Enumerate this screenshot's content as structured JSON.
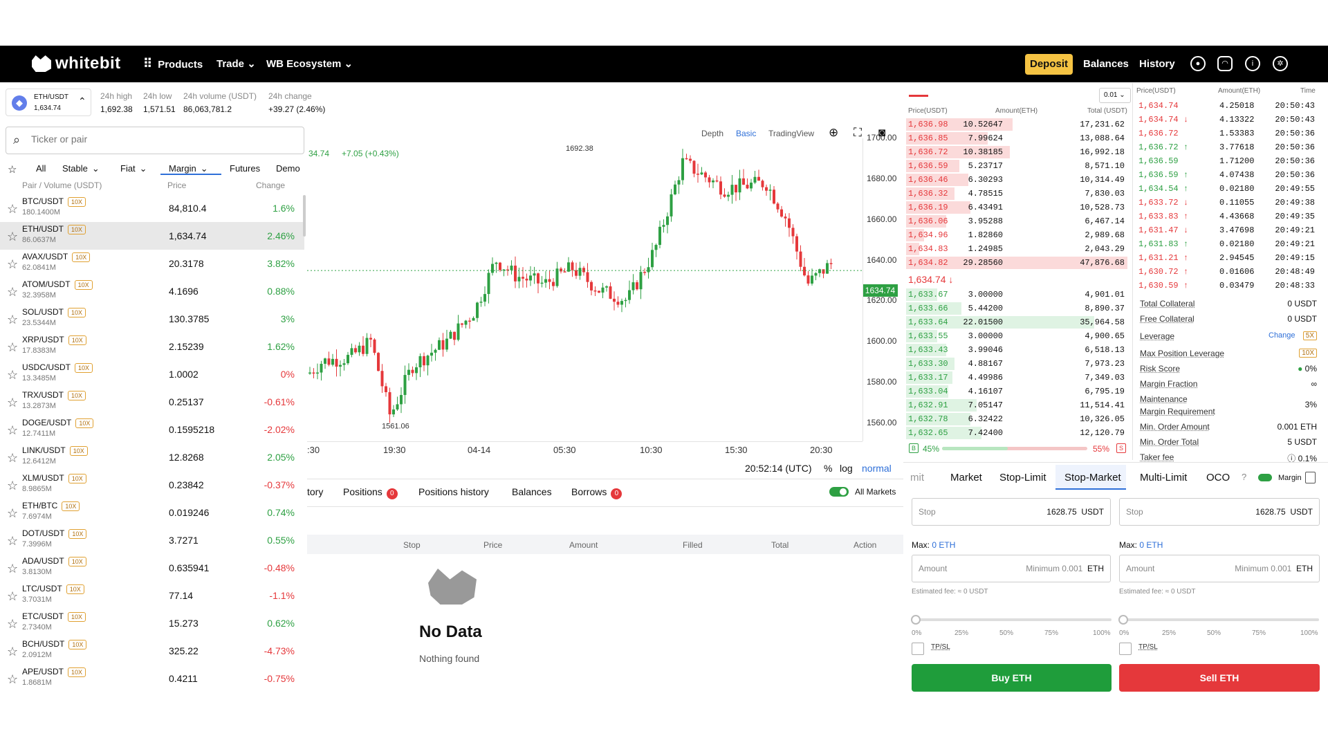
{
  "header": {
    "logo": "whitebit",
    "nav": {
      "products": "Products",
      "trade": "Trade",
      "ecosystem": "WB Ecosystem"
    },
    "deposit": "Deposit",
    "balances": "Balances",
    "history": "History"
  },
  "ticker": {
    "pair": "ETH/USDT",
    "price": "1,634.74",
    "high_label": "24h high",
    "high": "1,692.38",
    "low_label": "24h low",
    "low": "1,571.51",
    "vol_label": "24h volume (USDT)",
    "vol": "86,063,781.2",
    "chg_label": "24h change",
    "chg": "+39.27  (2.46%)"
  },
  "markets": {
    "search_placeholder": "Ticker or pair",
    "filters": [
      "All",
      "Stable",
      "Fiat",
      "Margin",
      "Futures",
      "Demo"
    ],
    "head": {
      "pair": "Pair / Volume (USDT)",
      "price": "Price",
      "change": "Change"
    },
    "rows": [
      {
        "pair": "BTC/USDT",
        "lev": "10X",
        "vol": "180.1400M",
        "price": "84,810.4",
        "chg": "1.6%",
        "up": true
      },
      {
        "pair": "ETH/USDT",
        "lev": "10X",
        "vol": "86.0637M",
        "price": "1,634.74",
        "chg": "2.46%",
        "up": true
      },
      {
        "pair": "AVAX/USDT",
        "lev": "10X",
        "vol": "62.0841M",
        "price": "20.3178",
        "chg": "3.82%",
        "up": true
      },
      {
        "pair": "ATOM/USDT",
        "lev": "10X",
        "vol": "32.3958M",
        "price": "4.1696",
        "chg": "0.88%",
        "up": true
      },
      {
        "pair": "SOL/USDT",
        "lev": "10X",
        "vol": "23.5344M",
        "price": "130.3785",
        "chg": "3%",
        "up": true
      },
      {
        "pair": "XRP/USDT",
        "lev": "10X",
        "vol": "17.8383M",
        "price": "2.15239",
        "chg": "1.62%",
        "up": true
      },
      {
        "pair": "USDC/USDT",
        "lev": "10X",
        "vol": "13.3485M",
        "price": "1.0002",
        "chg": "0%",
        "up": false
      },
      {
        "pair": "TRX/USDT",
        "lev": "10X",
        "vol": "13.2873M",
        "price": "0.25137",
        "chg": "-0.61%",
        "up": false
      },
      {
        "pair": "DOGE/USDT",
        "lev": "10X",
        "vol": "12.7411M",
        "price": "0.1595218",
        "chg": "-2.02%",
        "up": false
      },
      {
        "pair": "LINK/USDT",
        "lev": "10X",
        "vol": "12.6412M",
        "price": "12.8268",
        "chg": "2.05%",
        "up": true
      },
      {
        "pair": "XLM/USDT",
        "lev": "10X",
        "vol": "8.9865M",
        "price": "0.23842",
        "chg": "-0.37%",
        "up": false
      },
      {
        "pair": "ETH/BTC",
        "lev": "10X",
        "vol": "7.6974M",
        "price": "0.019246",
        "chg": "0.74%",
        "up": true
      },
      {
        "pair": "DOT/USDT",
        "lev": "10X",
        "vol": "7.3996M",
        "price": "3.7271",
        "chg": "0.55%",
        "up": true
      },
      {
        "pair": "ADA/USDT",
        "lev": "10X",
        "vol": "3.8130M",
        "price": "0.635941",
        "chg": "-0.48%",
        "up": false
      },
      {
        "pair": "LTC/USDT",
        "lev": "10X",
        "vol": "3.7031M",
        "price": "77.14",
        "chg": "-1.1%",
        "up": false
      },
      {
        "pair": "ETC/USDT",
        "lev": "10X",
        "vol": "2.7340M",
        "price": "15.273",
        "chg": "0.62%",
        "up": true
      },
      {
        "pair": "BCH/USDT",
        "lev": "10X",
        "vol": "2.0912M",
        "price": "325.22",
        "chg": "-4.73%",
        "up": false
      },
      {
        "pair": "APE/USDT",
        "lev": "10X",
        "vol": "1.8681M",
        "price": "0.4211",
        "chg": "-0.75%",
        "up": false
      }
    ]
  },
  "chart": {
    "tabs": {
      "depth": "Depth",
      "basic": "Basic",
      "tradingview": "TradingView"
    },
    "legend_price": "34.74",
    "legend_change": "+7.05 (+0.43%)",
    "y_ticks": [
      "1700.00",
      "1680.00",
      "1660.00",
      "1640.00",
      "1620.00",
      "1600.00",
      "1580.00",
      "1560.00"
    ],
    "x_ticks": [
      ":30",
      "19:30",
      "04-14",
      "05:30",
      "10:30",
      "15:30",
      "20:30"
    ],
    "last_price": "1634.74",
    "high_mark": "1692.38",
    "low_mark": "1561.06",
    "clock": "20:52:14 (UTC)",
    "pct": "%",
    "log": "log",
    "normal": "normal"
  },
  "chart_data": {
    "type": "candlestick",
    "ylim": [
      1550,
      1710
    ],
    "x_ticks": [
      "19:30",
      "04-14",
      "05:30",
      "10:30",
      "15:30",
      "20:30"
    ],
    "last": 1634.74,
    "high": 1692.38,
    "low": 1561.06
  },
  "bottom": {
    "tabs": [
      "tory",
      "Positions",
      "Positions history",
      "Balances",
      "Borrows"
    ],
    "positions_count": "0",
    "borrows_count": "0",
    "all_markets": "All Markets",
    "cols": [
      "Stop",
      "Price",
      "Amount",
      "Filled",
      "Total",
      "Action"
    ],
    "empty_title": "No Data",
    "empty_sub": "Nothing found"
  },
  "orderbook": {
    "step": "0.01",
    "head": {
      "price": "Price(USDT)",
      "amount": "Amount(ETH)",
      "total": "Total (USDT)"
    },
    "asks": [
      [
        "1,636.98",
        "10.52647",
        "17,231.62",
        0.48
      ],
      [
        "1,636.85",
        "7.99624",
        "13,088.64",
        0.37
      ],
      [
        "1,636.72",
        "10.38185",
        "16,992.18",
        0.47
      ],
      [
        "1,636.59",
        "5.23717",
        "8,571.10",
        0.24
      ],
      [
        "1,636.46",
        "6.30293",
        "10,314.49",
        0.28
      ],
      [
        "1,636.32",
        "4.78515",
        "7,830.03",
        0.22
      ],
      [
        "1,636.19",
        "6.43491",
        "10,528.73",
        0.29
      ],
      [
        "1,636.06",
        "3.95288",
        "6,467.14",
        0.18
      ],
      [
        "1,634.96",
        "1.82860",
        "2,989.68",
        0.08
      ],
      [
        "1,634.83",
        "1.24985",
        "2,043.29",
        0.06
      ],
      [
        "1,634.82",
        "29.28560",
        "47,876.68",
        1.0
      ]
    ],
    "mid": "1,634.74 ↓",
    "bids": [
      [
        "1,633.67",
        "3.00000",
        "4,901.01",
        0.14
      ],
      [
        "1,633.66",
        "5.44200",
        "8,890.37",
        0.25
      ],
      [
        "1,633.64",
        "22.01500",
        "35,964.58",
        0.85
      ],
      [
        "1,633.55",
        "3.00000",
        "4,900.65",
        0.14
      ],
      [
        "1,633.43",
        "3.99046",
        "6,518.13",
        0.18
      ],
      [
        "1,633.30",
        "4.88167",
        "7,973.23",
        0.22
      ],
      [
        "1,633.17",
        "4.49986",
        "7,349.03",
        0.21
      ],
      [
        "1,633.04",
        "4.16107",
        "6,795.19",
        0.19
      ],
      [
        "1,632.91",
        "7.05147",
        "11,514.41",
        0.32
      ],
      [
        "1,632.78",
        "6.32422",
        "10,326.05",
        0.29
      ],
      [
        "1,632.65",
        "7.42400",
        "12,120.79",
        0.34
      ]
    ],
    "buy_pct": "45%",
    "sell_pct": "55%",
    "buy_fill": 0.45
  },
  "trades": {
    "head": {
      "price": "Price(USDT)",
      "amount": "Amount(ETH)",
      "time": "Time"
    },
    "rows": [
      [
        "1,634.74",
        "4.25018",
        "20:50:43",
        false
      ],
      [
        "1,634.74 ↓",
        "4.13322",
        "20:50:43",
        false
      ],
      [
        "1,636.72",
        "1.53383",
        "20:50:36",
        false
      ],
      [
        "1,636.72 ↑",
        "3.77618",
        "20:50:36",
        true
      ],
      [
        "1,636.59",
        "1.71200",
        "20:50:36",
        true
      ],
      [
        "1,636.59 ↑",
        "4.07438",
        "20:50:36",
        true
      ],
      [
        "1,634.54 ↑",
        "0.02180",
        "20:49:55",
        true
      ],
      [
        "1,633.72 ↓",
        "0.11055",
        "20:49:38",
        false
      ],
      [
        "1,633.83 ↑",
        "4.43668",
        "20:49:35",
        false
      ],
      [
        "1,631.47 ↓",
        "3.47698",
        "20:49:21",
        false
      ],
      [
        "1,631.83 ↑",
        "0.02180",
        "20:49:21",
        true
      ],
      [
        "1,631.21 ↑",
        "2.94545",
        "20:49:15",
        false
      ],
      [
        "1,630.72 ↑",
        "0.01606",
        "20:48:49",
        false
      ],
      [
        "1,630.59 ↑",
        "0.03479",
        "20:48:33",
        false
      ]
    ]
  },
  "account": {
    "total_collateral": "Total Collateral",
    "total_collateral_v": "0 USDT",
    "free_collateral": "Free Collateral",
    "free_collateral_v": "0 USDT",
    "leverage": "Leverage",
    "change": "Change",
    "leverage_v": "5X",
    "max_pos_lev": "Max Position Leverage",
    "max_pos_lev_v": "10X",
    "risk": "Risk Score",
    "risk_v": "0%",
    "margin_fraction": "Margin Fraction",
    "margin_fraction_v": "∞",
    "maint1": "Maintenance",
    "maint2": "Margin Requirement",
    "maint_v": "3%",
    "min_amount": "Min. Order Amount",
    "min_amount_v": "0.001 ETH",
    "min_total": "Min. Order Total",
    "min_total_v": "5 USDT",
    "taker": "Taker fee",
    "taker_v": "0.1%"
  },
  "order": {
    "tabs": [
      "mit",
      "Market",
      "Stop-Limit",
      "Stop-Market",
      "Multi-Limit",
      "OCO"
    ],
    "margin": "Margin",
    "stop_label": "Stop",
    "stop_val": "1628.75",
    "usdt": "USDT",
    "max": "Max:",
    "max_val": "0 ETH",
    "amount_label": "Amount",
    "amount_min": "Minimum 0.001",
    "eth": "ETH",
    "fee": "Estimated fee: ≈ 0 USDT",
    "pcts": [
      "0%",
      "25%",
      "50%",
      "75%",
      "100%"
    ],
    "tpsl": "TP/SL",
    "buy": "Buy ETH",
    "sell": "Sell ETH"
  },
  "colors": {
    "green": "#2ea043",
    "red": "#e5383b",
    "accent": "#f5c343",
    "blue": "#2e6fd8"
  }
}
